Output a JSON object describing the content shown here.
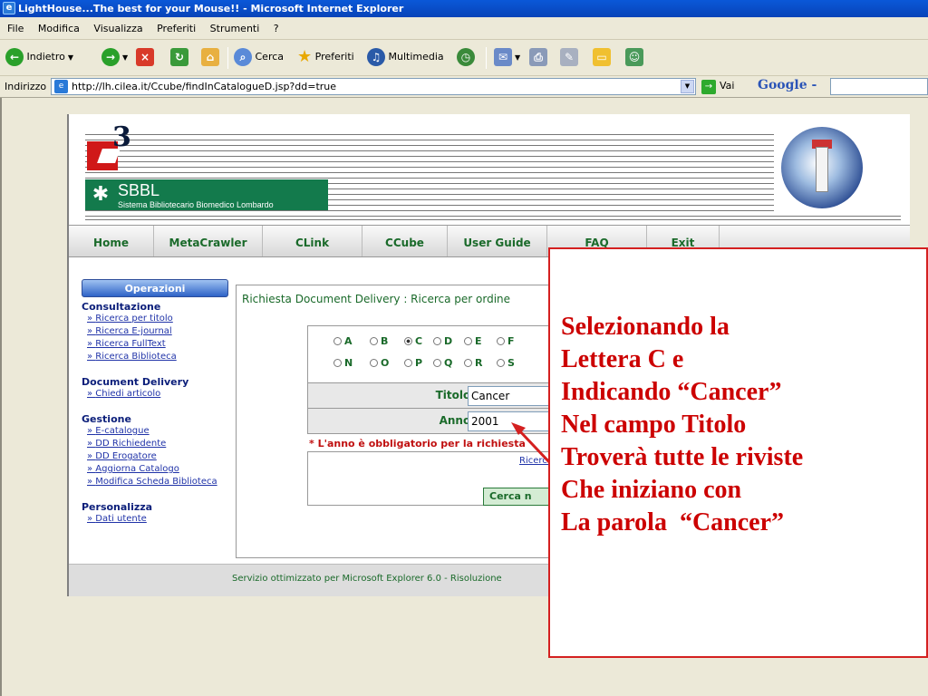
{
  "window": {
    "title": "LightHouse...The best for your Mouse!! - Microsoft Internet Explorer"
  },
  "menu": [
    "File",
    "Modifica",
    "Visualizza",
    "Preferiti",
    "Strumenti",
    "?"
  ],
  "toolbar": {
    "back": "Indietro",
    "search": "Cerca",
    "favorites": "Preferiti",
    "media": "Multimedia"
  },
  "address": {
    "label": "Indirizzo",
    "url": "http://lh.cilea.it/Ccube/findInCatalogueD.jsp?dd=true",
    "go": "Vai",
    "google": "Google -"
  },
  "banner": {
    "logo_num": "3",
    "org_abbr": "SBBL",
    "org_name": "Sistema Bibliotecario Biomedico Lombardo"
  },
  "nav": [
    "Home",
    "MetaCrawler",
    "CLink",
    "CCube",
    "User Guide",
    "FAQ",
    "Exit"
  ],
  "sidebar": {
    "header": "Operazioni",
    "sections": [
      {
        "title": "Consultazione",
        "links": [
          "Ricerca per titolo",
          "Ricerca E-journal",
          "Ricerca FullText",
          "Ricerca Biblioteca"
        ]
      },
      {
        "title": "Document Delivery",
        "links": [
          "Chiedi articolo"
        ]
      },
      {
        "title": "Gestione",
        "links": [
          "E-catalogue",
          "DD Richiedente",
          "DD Erogatore",
          "Aggiorna Catalogo",
          "Modifica Scheda Biblioteca"
        ]
      },
      {
        "title": "Personalizza",
        "links": [
          "Dati utente"
        ]
      }
    ]
  },
  "main": {
    "title": "Richiesta Document Delivery : Ricerca per ordine",
    "letters_row1": [
      "A",
      "B",
      "C",
      "D",
      "E",
      "F"
    ],
    "letters_row2": [
      "N",
      "O",
      "P",
      "Q",
      "R",
      "S"
    ],
    "selected_letter": "C",
    "titolo_label": "Titolo:",
    "titolo_value": "Cancer",
    "anno_label": "Anno:",
    "anno_value": "2001",
    "anno_note": "* L'anno è obbligatorio per la richiesta",
    "ricerca_link": "Ricerca",
    "cerca_button": "Cerca n"
  },
  "footer": {
    "text": "Servizio ottimizzato per Microsoft Explorer 6.0 - Risoluzione"
  },
  "callout": {
    "lines": [
      "Selezionando la",
      "Lettera C e",
      "Indicando “Cancer”",
      "Nel campo Titolo",
      "Troverà tutte le riviste",
      "Che iniziano con",
      "La parola  “Cancer”"
    ],
    "color": "#cc0000"
  }
}
